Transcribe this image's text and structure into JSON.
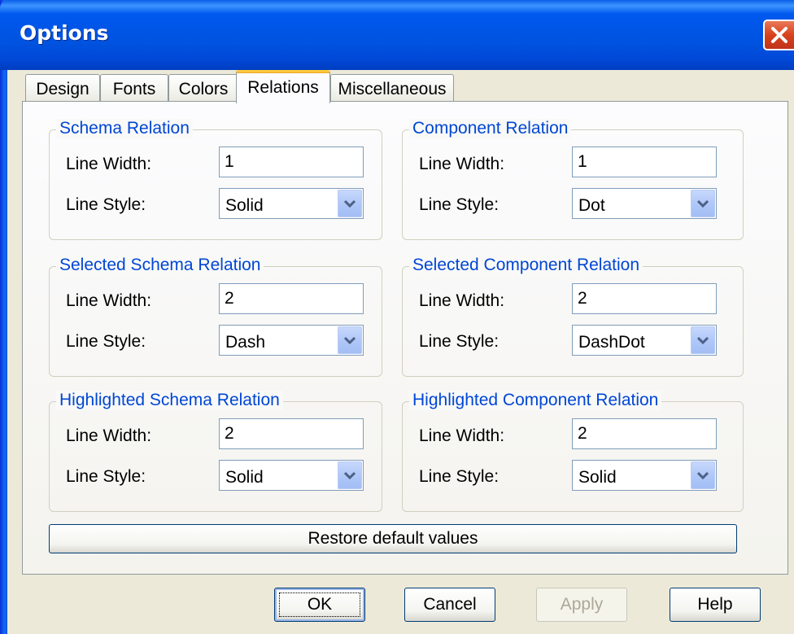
{
  "window": {
    "title": "Options"
  },
  "tabs": [
    {
      "label": "Design"
    },
    {
      "label": "Fonts"
    },
    {
      "label": "Colors"
    },
    {
      "label": "Relations"
    },
    {
      "label": "Miscellaneous"
    }
  ],
  "groups": [
    {
      "title": "Schema Relation",
      "width_label": "Line Width:",
      "width_value": "1",
      "style_label": "Line Style:",
      "style_value": "Solid"
    },
    {
      "title": "Component Relation",
      "width_label": "Line Width:",
      "width_value": "1",
      "style_label": "Line Style:",
      "style_value": "Dot"
    },
    {
      "title": "Selected Schema Relation",
      "width_label": "Line Width:",
      "width_value": "2",
      "style_label": "Line Style:",
      "style_value": "Dash"
    },
    {
      "title": "Selected Component Relation",
      "width_label": "Line Width:",
      "width_value": "2",
      "style_label": "Line Style:",
      "style_value": "DashDot"
    },
    {
      "title": "Highlighted Schema Relation",
      "width_label": "Line Width:",
      "width_value": "2",
      "style_label": "Line Style:",
      "style_value": "Solid"
    },
    {
      "title": "Highlighted Component Relation",
      "width_label": "Line Width:",
      "width_value": "2",
      "style_label": "Line Style:",
      "style_value": "Solid"
    }
  ],
  "restore_label": "Restore default values",
  "buttons": {
    "ok": "OK",
    "cancel": "Cancel",
    "apply": "Apply",
    "help": "Help"
  }
}
